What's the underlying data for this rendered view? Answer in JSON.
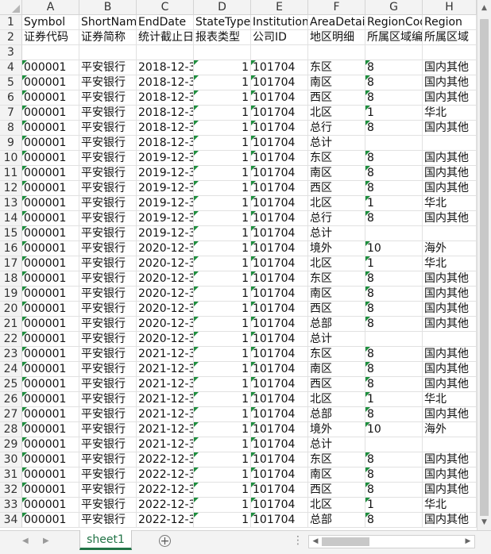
{
  "columns": [
    {
      "letter": "A",
      "width": 72
    },
    {
      "letter": "B",
      "width": 72
    },
    {
      "letter": "C",
      "width": 72
    },
    {
      "letter": "D",
      "width": 72
    },
    {
      "letter": "E",
      "width": 72
    },
    {
      "letter": "F",
      "width": 72
    },
    {
      "letter": "G",
      "width": 72
    },
    {
      "letter": "H",
      "width": 68
    }
  ],
  "header_row1": [
    "Symbol",
    "ShortName",
    "EndDate",
    "StateTypeC",
    "InstitutionI",
    "AreaDetail",
    "RegionCod",
    "Region"
  ],
  "header_row2": [
    "证券代码",
    "证券简称",
    "统计截止日",
    "报表类型",
    "公司ID",
    "地区明细",
    "所属区域编",
    "所属区域"
  ],
  "rows": [
    {
      "n": "4",
      "a": "000001",
      "b": "平安银行",
      "c": "2018-12-3",
      "d": "1",
      "e": "101704",
      "f": "东区",
      "g": "8",
      "h": "国内其他"
    },
    {
      "n": "5",
      "a": "000001",
      "b": "平安银行",
      "c": "2018-12-3",
      "d": "1",
      "e": "101704",
      "f": "南区",
      "g": "8",
      "h": "国内其他"
    },
    {
      "n": "6",
      "a": "000001",
      "b": "平安银行",
      "c": "2018-12-3",
      "d": "1",
      "e": "101704",
      "f": "西区",
      "g": "8",
      "h": "国内其他"
    },
    {
      "n": "7",
      "a": "000001",
      "b": "平安银行",
      "c": "2018-12-3",
      "d": "1",
      "e": "101704",
      "f": "北区",
      "g": "1",
      "h": "华北"
    },
    {
      "n": "8",
      "a": "000001",
      "b": "平安银行",
      "c": "2018-12-3",
      "d": "1",
      "e": "101704",
      "f": "总行",
      "g": "8",
      "h": "国内其他"
    },
    {
      "n": "9",
      "a": "000001",
      "b": "平安银行",
      "c": "2018-12-3",
      "d": "1",
      "e": "101704",
      "f": "总计",
      "g": "",
      "h": ""
    },
    {
      "n": "10",
      "a": "000001",
      "b": "平安银行",
      "c": "2019-12-3",
      "d": "1",
      "e": "101704",
      "f": "东区",
      "g": "8",
      "h": "国内其他"
    },
    {
      "n": "11",
      "a": "000001",
      "b": "平安银行",
      "c": "2019-12-3",
      "d": "1",
      "e": "101704",
      "f": "南区",
      "g": "8",
      "h": "国内其他"
    },
    {
      "n": "12",
      "a": "000001",
      "b": "平安银行",
      "c": "2019-12-3",
      "d": "1",
      "e": "101704",
      "f": "西区",
      "g": "8",
      "h": "国内其他"
    },
    {
      "n": "13",
      "a": "000001",
      "b": "平安银行",
      "c": "2019-12-3",
      "d": "1",
      "e": "101704",
      "f": "北区",
      "g": "1",
      "h": "华北"
    },
    {
      "n": "14",
      "a": "000001",
      "b": "平安银行",
      "c": "2019-12-3",
      "d": "1",
      "e": "101704",
      "f": "总行",
      "g": "8",
      "h": "国内其他"
    },
    {
      "n": "15",
      "a": "000001",
      "b": "平安银行",
      "c": "2019-12-3",
      "d": "1",
      "e": "101704",
      "f": "总计",
      "g": "",
      "h": ""
    },
    {
      "n": "16",
      "a": "000001",
      "b": "平安银行",
      "c": "2020-12-3",
      "d": "1",
      "e": "101704",
      "f": "境外",
      "g": "10",
      "h": "海外"
    },
    {
      "n": "17",
      "a": "000001",
      "b": "平安银行",
      "c": "2020-12-3",
      "d": "1",
      "e": "101704",
      "f": "北区",
      "g": "1",
      "h": "华北"
    },
    {
      "n": "18",
      "a": "000001",
      "b": "平安银行",
      "c": "2020-12-3",
      "d": "1",
      "e": "101704",
      "f": "东区",
      "g": "8",
      "h": "国内其他"
    },
    {
      "n": "19",
      "a": "000001",
      "b": "平安银行",
      "c": "2020-12-3",
      "d": "1",
      "e": "101704",
      "f": "南区",
      "g": "8",
      "h": "国内其他"
    },
    {
      "n": "20",
      "a": "000001",
      "b": "平安银行",
      "c": "2020-12-3",
      "d": "1",
      "e": "101704",
      "f": "西区",
      "g": "8",
      "h": "国内其他"
    },
    {
      "n": "21",
      "a": "000001",
      "b": "平安银行",
      "c": "2020-12-3",
      "d": "1",
      "e": "101704",
      "f": "总部",
      "g": "8",
      "h": "国内其他"
    },
    {
      "n": "22",
      "a": "000001",
      "b": "平安银行",
      "c": "2020-12-3",
      "d": "1",
      "e": "101704",
      "f": "总计",
      "g": "",
      "h": ""
    },
    {
      "n": "23",
      "a": "000001",
      "b": "平安银行",
      "c": "2021-12-3",
      "d": "1",
      "e": "101704",
      "f": "东区",
      "g": "8",
      "h": "国内其他"
    },
    {
      "n": "24",
      "a": "000001",
      "b": "平安银行",
      "c": "2021-12-3",
      "d": "1",
      "e": "101704",
      "f": "南区",
      "g": "8",
      "h": "国内其他"
    },
    {
      "n": "25",
      "a": "000001",
      "b": "平安银行",
      "c": "2021-12-3",
      "d": "1",
      "e": "101704",
      "f": "西区",
      "g": "8",
      "h": "国内其他"
    },
    {
      "n": "26",
      "a": "000001",
      "b": "平安银行",
      "c": "2021-12-3",
      "d": "1",
      "e": "101704",
      "f": "北区",
      "g": "1",
      "h": "华北"
    },
    {
      "n": "27",
      "a": "000001",
      "b": "平安银行",
      "c": "2021-12-3",
      "d": "1",
      "e": "101704",
      "f": "总部",
      "g": "8",
      "h": "国内其他"
    },
    {
      "n": "28",
      "a": "000001",
      "b": "平安银行",
      "c": "2021-12-3",
      "d": "1",
      "e": "101704",
      "f": "境外",
      "g": "10",
      "h": "海外"
    },
    {
      "n": "29",
      "a": "000001",
      "b": "平安银行",
      "c": "2021-12-3",
      "d": "1",
      "e": "101704",
      "f": "总计",
      "g": "",
      "h": ""
    },
    {
      "n": "30",
      "a": "000001",
      "b": "平安银行",
      "c": "2022-12-3",
      "d": "1",
      "e": "101704",
      "f": "东区",
      "g": "8",
      "h": "国内其他"
    },
    {
      "n": "31",
      "a": "000001",
      "b": "平安银行",
      "c": "2022-12-3",
      "d": "1",
      "e": "101704",
      "f": "南区",
      "g": "8",
      "h": "国内其他"
    },
    {
      "n": "32",
      "a": "000001",
      "b": "平安银行",
      "c": "2022-12-3",
      "d": "1",
      "e": "101704",
      "f": "西区",
      "g": "8",
      "h": "国内其他"
    },
    {
      "n": "33",
      "a": "000001",
      "b": "平安银行",
      "c": "2022-12-3",
      "d": "1",
      "e": "101704",
      "f": "北区",
      "g": "1",
      "h": "华北"
    },
    {
      "n": "34",
      "a": "000001",
      "b": "平安银行",
      "c": "2022-12-3",
      "d": "1",
      "e": "101704",
      "f": "总部",
      "g": "8",
      "h": "国内其他"
    }
  ],
  "sheet_tabs": [
    "sheet1"
  ],
  "colors": {
    "accent": "#217346",
    "cell_flag": "#1e8e3e"
  },
  "icons": {
    "scroll_up": "triangle-up-icon",
    "scroll_down": "triangle-down-icon",
    "scroll_left": "triangle-left-icon",
    "scroll_right": "triangle-right-icon",
    "add_sheet": "plus-circle-icon",
    "more": "ellipsis-icon"
  }
}
